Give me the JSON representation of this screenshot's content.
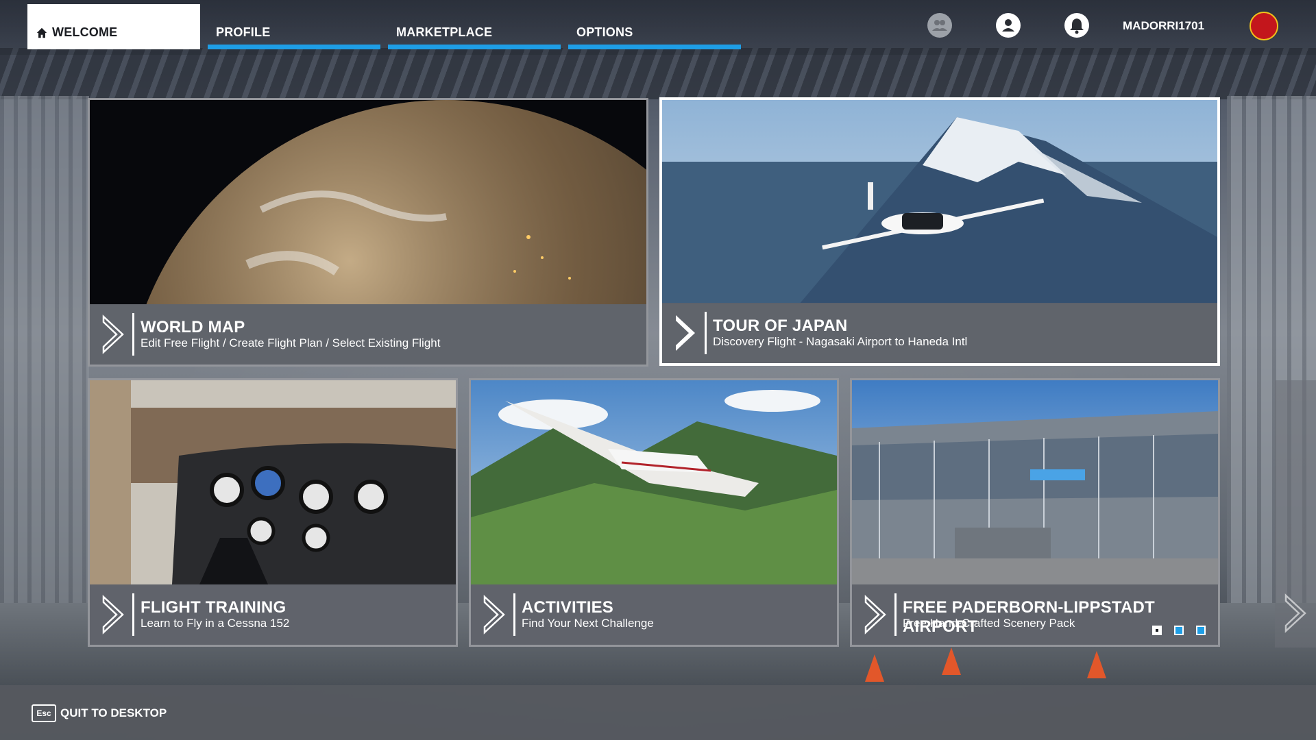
{
  "nav": {
    "tabs": [
      {
        "label": "WELCOME",
        "active": true
      },
      {
        "label": "PROFILE",
        "active": false
      },
      {
        "label": "MARKETPLACE",
        "active": false
      },
      {
        "label": "OPTIONS",
        "active": false
      }
    ],
    "icons": [
      "friends-icon",
      "profile-icon",
      "notifications-icon"
    ],
    "username": "MADORRI1701"
  },
  "cards": [
    {
      "title": "WORLD MAP",
      "subtitle": "Edit Free Flight / Create Flight Plan / Select Existing Flight"
    },
    {
      "title": "TOUR OF JAPAN",
      "subtitle": "Discovery Flight - Nagasaki Airport to Haneda Intl",
      "selected": true
    },
    {
      "title": "FLIGHT TRAINING",
      "subtitle": "Learn to Fly in a Cessna 152"
    },
    {
      "title": "ACTIVITIES",
      "subtitle": "Find Your Next Challenge"
    },
    {
      "title": "FREE PADERBORN-LIPPSTADT AIRPORT",
      "subtitle": "Free Hand-Crafted Scenery Pack",
      "pager": {
        "count": 3,
        "current": 1
      }
    }
  ],
  "footer": {
    "key": "Esc",
    "label": "QUIT TO DESKTOP"
  },
  "colors": {
    "accent": "#1e9ee6",
    "avatar": "#c3161c"
  }
}
